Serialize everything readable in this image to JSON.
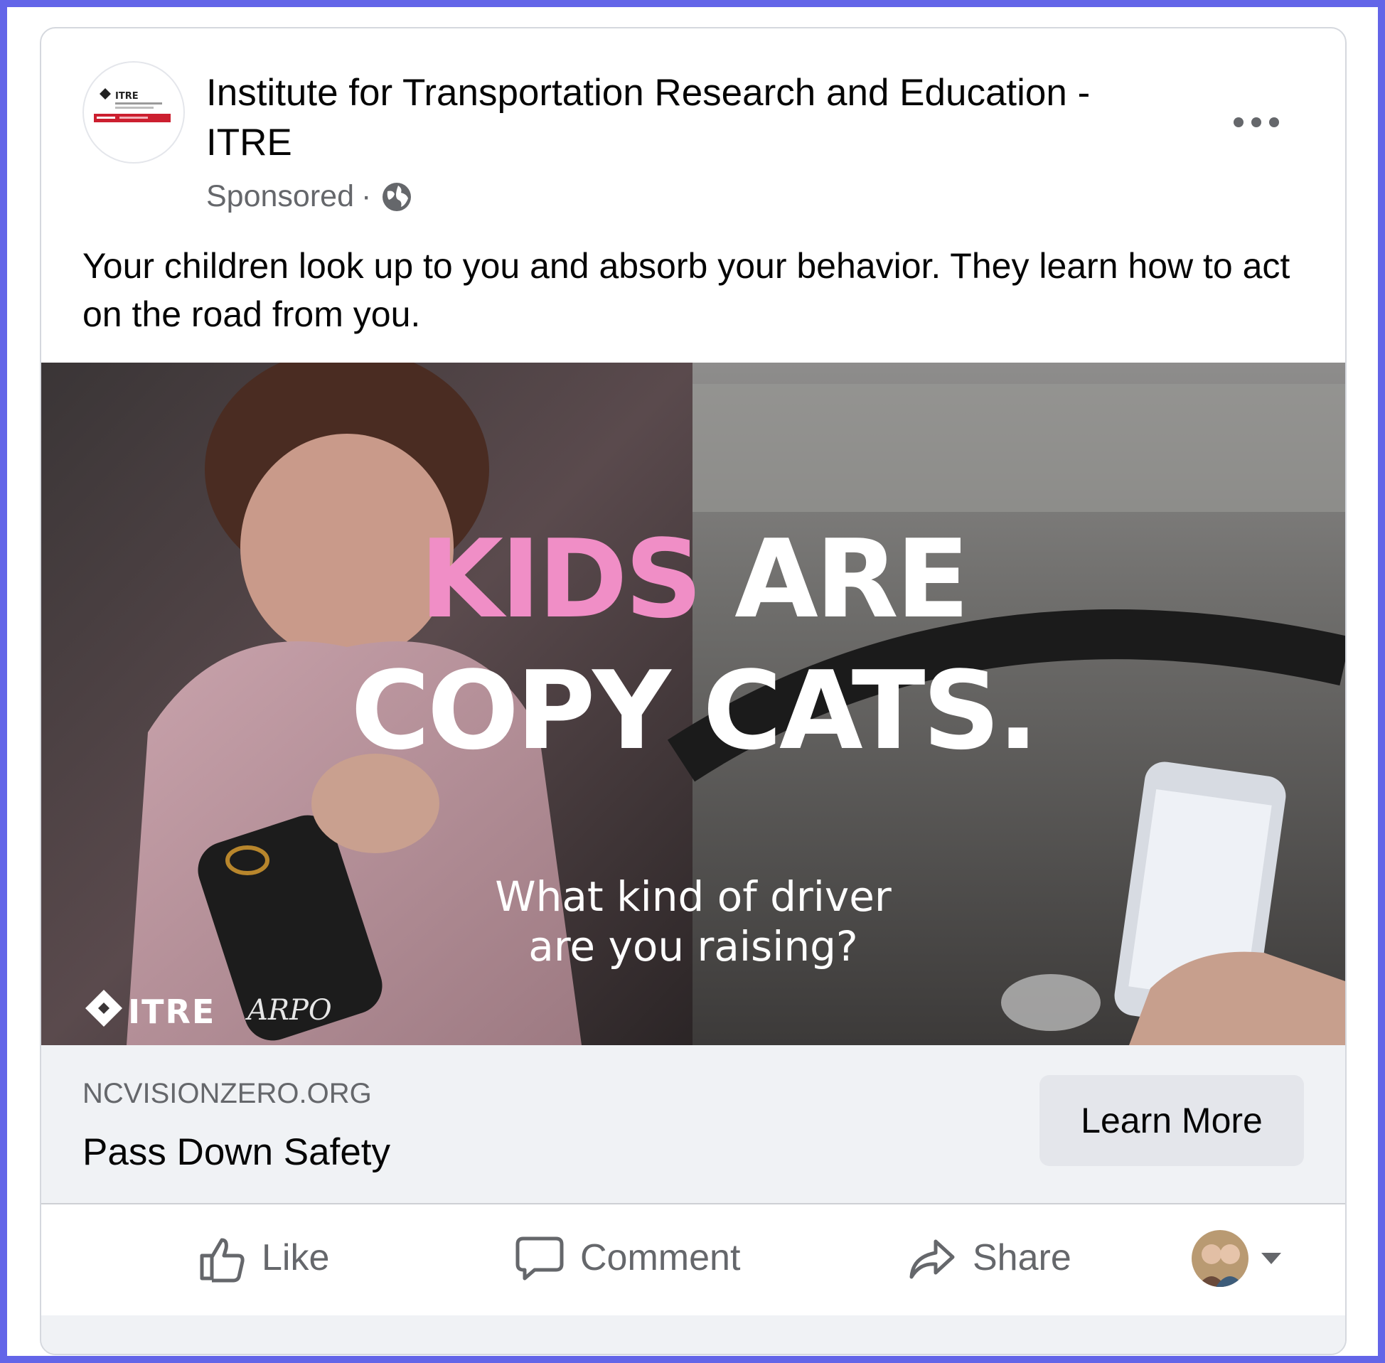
{
  "post": {
    "page_name": "Institute for Transportation Research and Education - ITRE",
    "sponsored_label": "Sponsored",
    "meta_separator": "·",
    "audience_icon": "globe-icon",
    "more_icon": "more-options-icon",
    "caption": "Your children look up to you and absorb your behavior. They learn how to act on the road from you."
  },
  "ad_image": {
    "headline_word_1": "KIDS",
    "headline_word_2": "ARE",
    "headline_line_2": "COPY CATS.",
    "subtext_line_1": "What kind of driver",
    "subtext_line_2": "are you raising?",
    "logo_1": "ITRE",
    "logo_2": "ARPO",
    "accent_color": "#f08ec6"
  },
  "link_preview": {
    "domain": "NCVISIONZERO.ORG",
    "title": "Pass Down Safety",
    "cta_label": "Learn More"
  },
  "actions": {
    "like_label": "Like",
    "comment_label": "Comment",
    "share_label": "Share"
  },
  "colors": {
    "page_background": "#6365e8",
    "secondary_text": "#65676b",
    "link_bar_background": "#f0f2f5",
    "button_background": "#e4e6eb"
  }
}
